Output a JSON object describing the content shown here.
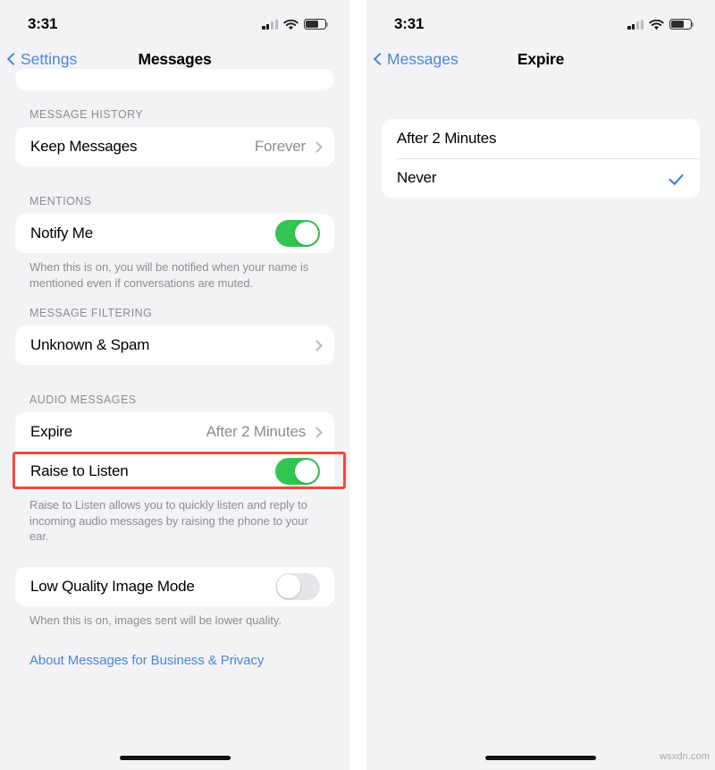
{
  "left_screen": {
    "status_bar": {
      "time": "3:31",
      "cellular_icon": "cellular-bars-icon",
      "cellular_bars_filled": 2,
      "cellular_bars_total": 4,
      "wifi_icon": "wifi-icon",
      "battery_icon": "battery-icon",
      "battery_level_percent": 60
    },
    "nav": {
      "back_label": "Settings",
      "back_icon": "chevron-left-icon",
      "title": "Messages"
    },
    "sections": {
      "message_history": {
        "header": "MESSAGE HISTORY",
        "rows": [
          {
            "label": "Keep Messages",
            "value": "Forever",
            "accessory": "chevron-right-icon"
          }
        ]
      },
      "mentions": {
        "header": "MENTIONS",
        "rows": [
          {
            "label": "Notify Me",
            "accessory": "toggle",
            "toggle_state": "on"
          }
        ],
        "footnote": "When this is on, you will be notified when your name is mentioned even if conversations are muted."
      },
      "message_filtering": {
        "header": "MESSAGE FILTERING",
        "rows": [
          {
            "label": "Unknown & Spam",
            "value": "",
            "accessory": "chevron-right-icon"
          }
        ]
      },
      "audio_messages": {
        "header": "AUDIO MESSAGES",
        "rows": [
          {
            "label": "Expire",
            "value": "After 2 Minutes",
            "accessory": "chevron-right-icon",
            "highlighted": true
          },
          {
            "label": "Raise to Listen",
            "accessory": "toggle",
            "toggle_state": "on"
          }
        ],
        "footnote": "Raise to Listen allows you to quickly listen and reply to incoming audio messages by raising the phone to your ear."
      },
      "image_quality": {
        "rows": [
          {
            "label": "Low Quality Image Mode",
            "accessory": "toggle",
            "toggle_state": "off"
          }
        ],
        "footnote": "When this is on, images sent will be lower quality."
      }
    },
    "about_link": "About Messages for Business & Privacy",
    "home_indicator": "home-indicator"
  },
  "right_screen": {
    "status_bar": {
      "time": "3:31",
      "cellular_icon": "cellular-bars-icon",
      "cellular_bars_filled": 2,
      "cellular_bars_total": 4,
      "wifi_icon": "wifi-icon",
      "battery_icon": "battery-icon",
      "battery_level_percent": 60
    },
    "nav": {
      "back_label": "Messages",
      "back_icon": "chevron-left-icon",
      "title": "Expire"
    },
    "options": [
      {
        "label": "After 2 Minutes",
        "selected": false
      },
      {
        "label": "Never",
        "selected": true,
        "accessory": "checkmark-icon"
      }
    ],
    "home_indicator": "home-indicator"
  },
  "annotation": {
    "highlight_color": "#ef4b3b",
    "highlight_target": "Expire"
  },
  "colors": {
    "accent_blue": "#4a86d4",
    "checkmark_blue": "#2a7fe0",
    "toggle_on_green": "#31c552",
    "toggle_off_gray": "#e6e6ea",
    "page_background": "#f3f3f6",
    "card_background": "#ffffff",
    "secondary_text": "#8c8c93",
    "highlight_red": "#ef4b3b"
  },
  "watermark": "wsxdn.com"
}
